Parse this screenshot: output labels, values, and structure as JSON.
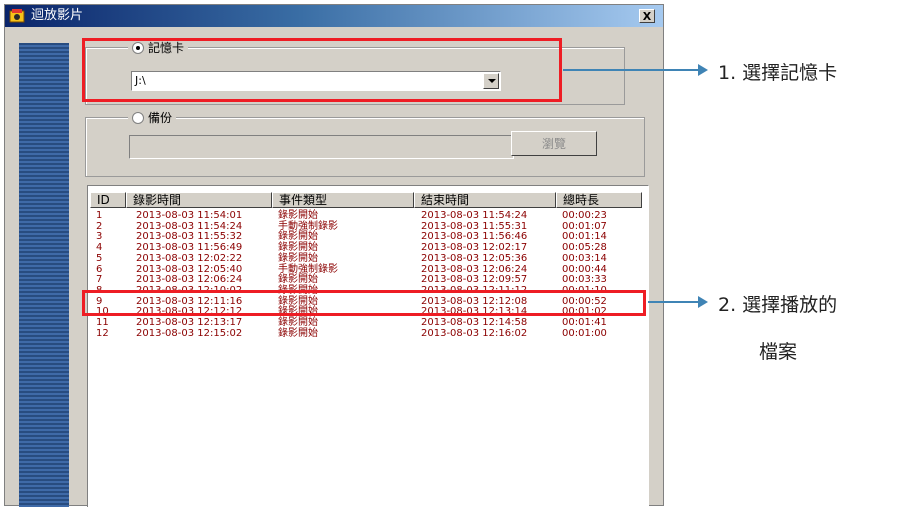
{
  "window": {
    "title": "迴放影片",
    "close_label": "X"
  },
  "memory_card_group": {
    "label": "記憶卡",
    "selected": true,
    "drive_value": "J:\\"
  },
  "backup_group": {
    "label": "備份",
    "selected": false,
    "path_value": "",
    "browse_label": "瀏覽"
  },
  "list": {
    "columns": [
      "ID",
      "錄影時間",
      "事件類型",
      "結束時間",
      "總時長"
    ],
    "rows": [
      {
        "id": "1",
        "start": "2013-08-03 11:54:01",
        "type": "錄影開始",
        "end": "2013-08-03 11:54:24",
        "duration": "00:00:23"
      },
      {
        "id": "2",
        "start": "2013-08-03 11:54:24",
        "type": "手動強制錄影",
        "end": "2013-08-03 11:55:31",
        "duration": "00:01:07"
      },
      {
        "id": "3",
        "start": "2013-08-03 11:55:32",
        "type": "錄影開始",
        "end": "2013-08-03 11:56:46",
        "duration": "00:01:14"
      },
      {
        "id": "4",
        "start": "2013-08-03 11:56:49",
        "type": "錄影開始",
        "end": "2013-08-03 12:02:17",
        "duration": "00:05:28"
      },
      {
        "id": "5",
        "start": "2013-08-03 12:02:22",
        "type": "錄影開始",
        "end": "2013-08-03 12:05:36",
        "duration": "00:03:14"
      },
      {
        "id": "6",
        "start": "2013-08-03 12:05:40",
        "type": "手動強制錄影",
        "end": "2013-08-03 12:06:24",
        "duration": "00:00:44"
      },
      {
        "id": "7",
        "start": "2013-08-03 12:06:24",
        "type": "錄影開始",
        "end": "2013-08-03 12:09:57",
        "duration": "00:03:33"
      },
      {
        "id": "8",
        "start": "2013-08-03 12:10:02",
        "type": "錄影開始",
        "end": "2013-08-03 12:11:12",
        "duration": "00:01:10"
      },
      {
        "id": "9",
        "start": "2013-08-03 12:11:16",
        "type": "錄影開始",
        "end": "2013-08-03 12:12:08",
        "duration": "00:00:52"
      },
      {
        "id": "10",
        "start": "2013-08-03 12:12:12",
        "type": "錄影開始",
        "end": "2013-08-03 12:13:14",
        "duration": "00:01:02"
      },
      {
        "id": "11",
        "start": "2013-08-03 12:13:17",
        "type": "錄影開始",
        "end": "2013-08-03 12:14:58",
        "duration": "00:01:41"
      },
      {
        "id": "12",
        "start": "2013-08-03 12:15:02",
        "type": "錄影開始",
        "end": "2013-08-03 12:16:02",
        "duration": "00:01:00"
      }
    ]
  },
  "annotations": {
    "step1": "1.   選擇記憶卡",
    "step2_line1": "2.   選擇播放的",
    "step2_line2": "檔案"
  },
  "colors": {
    "row_text": "#8b0000",
    "annotation_box": "#ee1d24",
    "annotation_arrow": "#3f84b5",
    "title_bar": "#0a246a"
  }
}
